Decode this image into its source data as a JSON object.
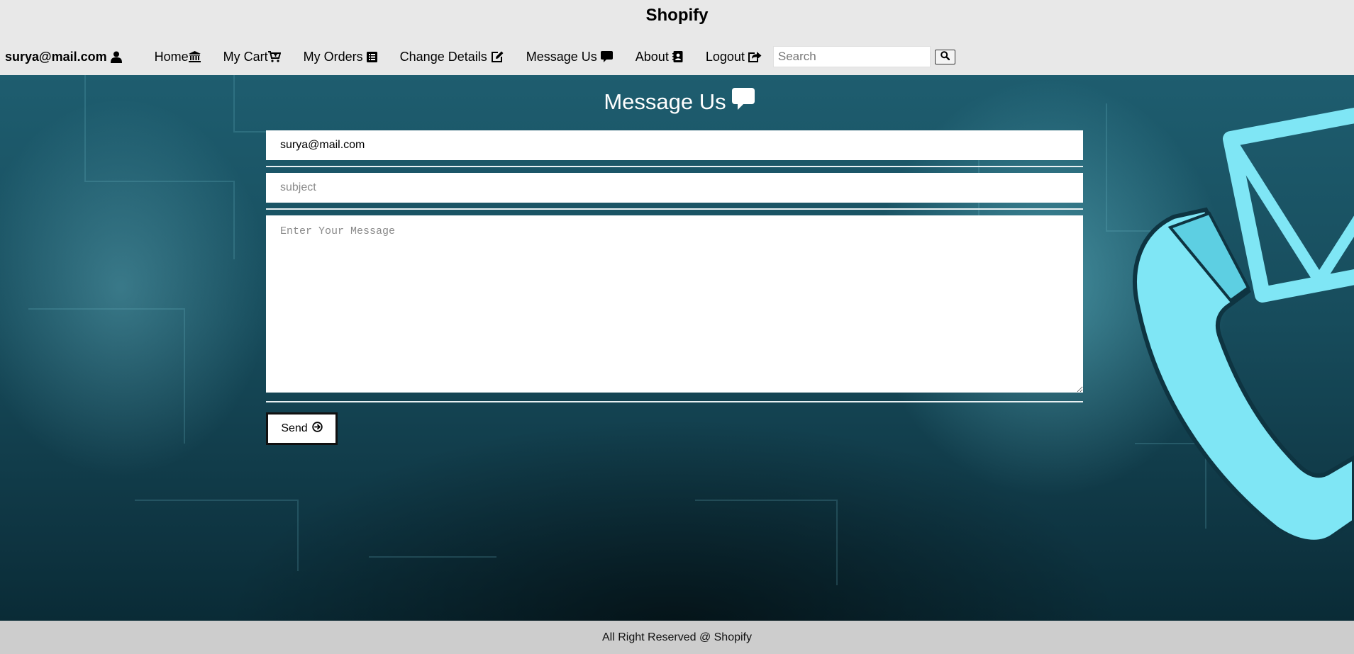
{
  "header": {
    "brand": "Shopify"
  },
  "nav": {
    "user_label": "surya@mail.com",
    "home_label": "Home",
    "cart_label": "My Cart",
    "orders_label": "My Orders",
    "change_details_label": "Change Details",
    "message_label": "Message Us",
    "about_label": "About",
    "logout_label": "Logout",
    "search_placeholder": "Search",
    "search_value": ""
  },
  "form": {
    "title": "Message Us",
    "email_value": "surya@mail.com",
    "subject_placeholder": "subject",
    "subject_value": "",
    "message_placeholder": "Enter Your Message",
    "message_value": "",
    "send_label": "Send"
  },
  "footer": {
    "text": "All Right Reserved @ Shopify"
  },
  "icons": {
    "user": "user-icon",
    "home": "bank-icon",
    "cart": "cart-plus-icon",
    "orders": "list-alt-icon",
    "change_details": "edit-icon",
    "message": "comment-icon",
    "about": "address-card-icon",
    "logout": "share-square-icon",
    "search": "search-icon",
    "send": "arrow-circle-right-icon",
    "background_phone": "phone-icon",
    "background_envelope": "envelope-icon"
  },
  "colors": {
    "header_bg": "#e8e8e8",
    "footer_bg": "#cdcdcd",
    "main_bg": "#174c5c",
    "accent_cyan": "#7fe6f5"
  }
}
